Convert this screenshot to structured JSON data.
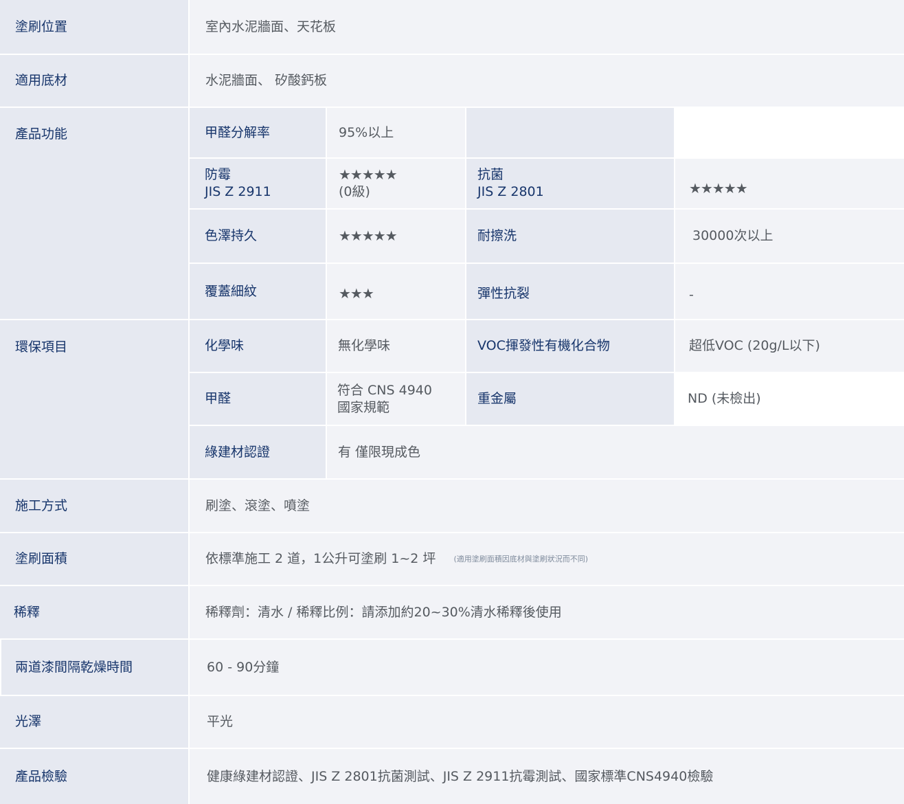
{
  "rows": {
    "position": {
      "label": "塗刷位置",
      "value": "室內水泥牆面、天花板"
    },
    "substrate": {
      "label": "適用底材",
      "value": "水泥牆面、 矽酸鈣板"
    },
    "functions": {
      "label": "產品功能",
      "formaldehyde_rate": {
        "label": "甲醛分解率",
        "value": "95%以上"
      },
      "mold": {
        "label_line1": "防霉",
        "label_line2": "JIS Z 2911",
        "stars": "★★★★★",
        "grade": "(0級)"
      },
      "antibacterial": {
        "label_line1": "抗菌",
        "label_line2": "JIS Z 2801",
        "stars": "★★★★★"
      },
      "color_retention": {
        "label": "色澤持久",
        "stars": "★★★★★"
      },
      "scrub": {
        "label": "耐擦洗",
        "value": "30000次以上"
      },
      "crack_cover": {
        "label": "覆蓋細紋",
        "stars": "★★★"
      },
      "elastic": {
        "label": "彈性抗裂",
        "value": "-"
      }
    },
    "environment": {
      "label": "環保項目",
      "odor": {
        "label": "化學味",
        "value": "無化學味"
      },
      "voc": {
        "label": "VOC揮發性有機化合物",
        "value": "超低VOC (20g/L以下)"
      },
      "formaldehyde": {
        "label": "甲醛",
        "value_line1": "符合 CNS 4940",
        "value_line2": "國家規範"
      },
      "heavy_metal": {
        "label": "重金屬",
        "value": "ND (未檢出)"
      },
      "green": {
        "label": "綠建材認證",
        "value": "有 僅限現成色"
      }
    },
    "method": {
      "label": "施工方式",
      "value": "刷塗、滾塗、噴塗"
    },
    "coverage": {
      "label": "塗刷面積",
      "value": "依標準施工 2 道，1公升可塗刷 1~2 坪",
      "note": "(適用塗刷面積因底材與塗刷狀況而不同)"
    },
    "dilution": {
      "label": "稀釋",
      "value": "稀釋劑：清水 / 稀釋比例：請添加約20~30%清水稀釋後使用"
    },
    "recoat": {
      "label": "兩道漆間隔乾燥時間",
      "value": "60 - 90分鐘"
    },
    "gloss": {
      "label": "光澤",
      "value": "平光"
    },
    "testing": {
      "label": "產品檢驗",
      "value": "健康綠建材認證、JIS Z 2801抗菌測試、JIS Z 2911抗霉測試、國家標準CNS4940檢驗"
    }
  },
  "colors": {
    "label_bg": "#e6e9f1",
    "value_bg": "#f2f3f7",
    "label_text": "#17356b",
    "value_text": "#555a60"
  }
}
